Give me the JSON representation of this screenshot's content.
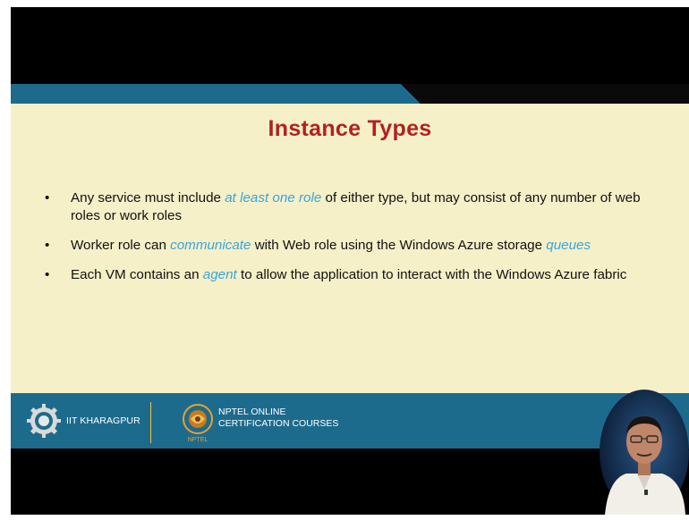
{
  "slide": {
    "title": "Instance Types",
    "bullets": [
      {
        "marker": "•",
        "parts": [
          "Any service must include ",
          "at least one role",
          " of either type, but may consist of any number of web roles or work roles"
        ]
      },
      {
        "marker": "•",
        "parts": [
          "Worker role can ",
          "communicate",
          " with Web role using the Windows Azure storage ",
          "queues"
        ]
      },
      {
        "marker": "•",
        "parts": [
          "Each VM contains an ",
          "agent",
          " to allow the application to interact with the Windows Azure fabric"
        ]
      }
    ]
  },
  "footer": {
    "iit_label": "IIT KHARAGPUR",
    "nptel_line1": "NPTEL ONLINE",
    "nptel_line2": "CERTIFICATION COURSES",
    "nptel_logo_text": "NPTEL"
  },
  "colors": {
    "slide_background": "#f5f0c8",
    "title": "#b42020",
    "highlight": "#39a4dc",
    "banner": "#1d6b8c",
    "footer_divider": "#f0c040"
  },
  "icons": {
    "iit_logo": "iit-kharagpur-emblem",
    "nptel_logo": "nptel-emblem",
    "presenter": "presenter-video-thumbnail"
  }
}
